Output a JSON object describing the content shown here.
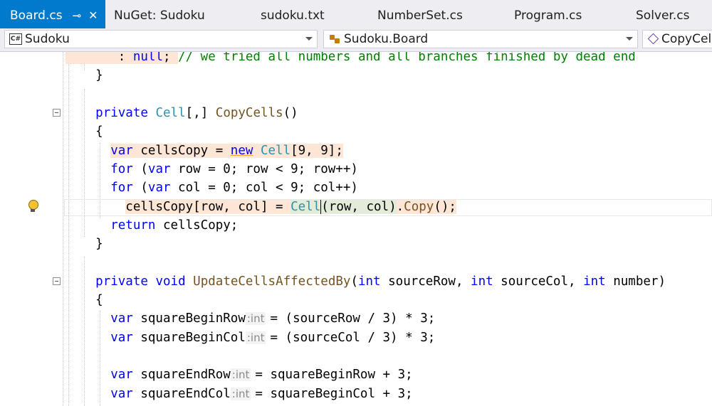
{
  "tabs": [
    {
      "label": "Board.cs",
      "active": true
    },
    {
      "label": "NuGet: Sudoku"
    },
    {
      "label": "sudoku.txt"
    },
    {
      "label": "NumberSet.cs"
    },
    {
      "label": "Program.cs"
    },
    {
      "label": "Solver.cs"
    }
  ],
  "tab_pin": "⊸",
  "tab_close": "✕",
  "nav": {
    "project": "Sudoku",
    "type": "Sudoku.Board",
    "member": "CopyCells()"
  },
  "code": {
    "l0_indent": "       ",
    "l0_a": ": ",
    "l0_null": "null",
    "l0_b": "; ",
    "l0_comment": "// we tried all numbers and all branches finished by dead end",
    "l1": "    }",
    "l3_private": "private",
    "l3_type": "Cell",
    "l3_arr": "[,] ",
    "l3_method": "CopyCells",
    "l3_paren": "()",
    "l4": "{",
    "l5_var": "var",
    "l5_name": " cellsCopy = ",
    "l5_new": "new",
    "l5_type": "Cell",
    "l5_rest": "[9, 9];",
    "l6_for": "for",
    "l6_a": " (",
    "l6_var": "var",
    "l6_rest": " row = 0; row < 9; row++)",
    "l7_for": "for",
    "l7_a": " (",
    "l7_var": "var",
    "l7_rest": " col = 0; col < 9; col++)",
    "l8_a": "cellsCopy[row, col] = ",
    "l8_cell_a": "Cell",
    "l8_cell_b": "(row, col)",
    "l8_dot": ".",
    "l8_copy": "Copy",
    "l8_end": "();",
    "l9_return": "return",
    "l9_rest": " cellsCopy;",
    "l10": "}",
    "l12_private": "private",
    "l12_void": "void",
    "l12_method": "UpdateCellsAffectedBy",
    "l12_p1": "(",
    "l12_int1": "int",
    "l12_a1": " sourceRow, ",
    "l12_int2": "int",
    "l12_a2": " sourceCol, ",
    "l12_int3": "int",
    "l12_a3": " number)",
    "l13": "{",
    "l14_var": "var",
    "l14_name": " squareBeginRow",
    "l14_hint": ":int",
    "l14_rest": "= (sourceRow / 3) * 3;",
    "l15_var": "var",
    "l15_name": " squareBeginCol",
    "l15_hint": ":int",
    "l15_rest": "= (sourceCol / 3) * 3;",
    "l17_var": "var",
    "l17_name": " squareEndRow",
    "l17_hint": ":int",
    "l17_rest": "= squareBeginRow + 3;",
    "l18_var": "var",
    "l18_name": " squareEndCol",
    "l18_hint": ":int",
    "l18_rest": "= squareBeginCol + 3;"
  },
  "colors": {
    "accent": "#007acc",
    "keyword": "#0000ff",
    "type": "#2b91af",
    "method": "#74531f",
    "comment": "#008000"
  }
}
